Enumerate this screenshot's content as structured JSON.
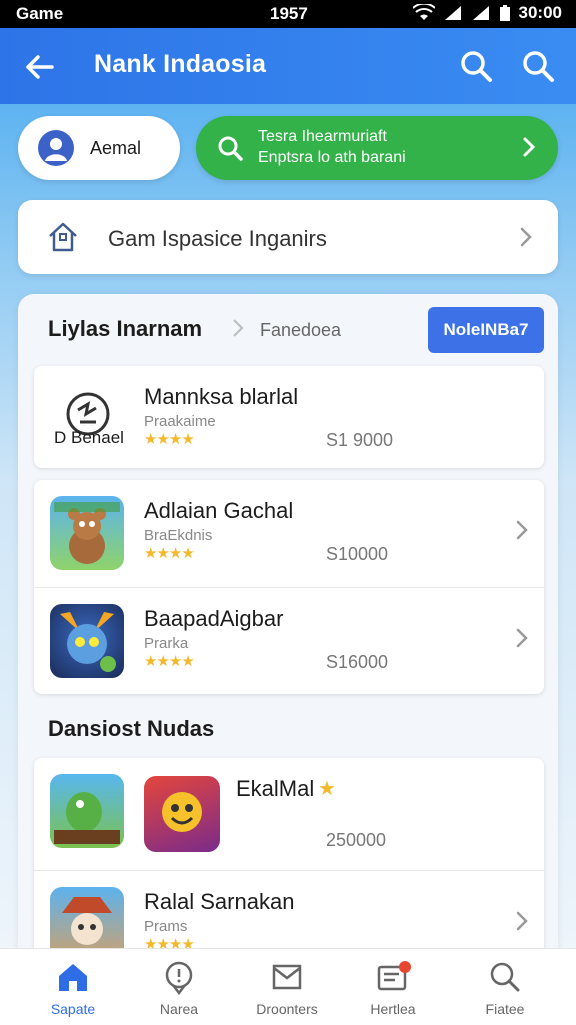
{
  "status_bar": {
    "carrier": "Game",
    "time": "1957",
    "clock": "30:00"
  },
  "app_bar": {
    "title": "Nank Indaosia"
  },
  "user_pill": {
    "label": "Aemal"
  },
  "search_pill": {
    "line1": "Tesra Ihearmuriaft",
    "line2": "Enptsra lo ath barani"
  },
  "banner": {
    "label": "Gam Ispasice Inganirs"
  },
  "panel": {
    "title": "Liylas Inarnam",
    "subtitle": "Fanedoea",
    "button_label": "NoleINBa7",
    "section_title": "Dansiost Nudas"
  },
  "card1": {
    "name": "Mannksa blarlal",
    "meta": "Praakaime",
    "price": "S1 9000",
    "icon_label": "D Benael"
  },
  "card2_rows": [
    {
      "name": "Adlaian Gachal",
      "meta": "BraEkdnis",
      "price": "S10000"
    },
    {
      "name": "BaapadAigbar",
      "meta": "Prarka",
      "price": "S16000"
    }
  ],
  "card3_rows": [
    {
      "name": "EkalMal",
      "price": "250000"
    },
    {
      "name": "Ralal Sarnakan",
      "meta": "Prams"
    }
  ],
  "stars": "★★★★",
  "bottom_nav": [
    {
      "label": "Sapate"
    },
    {
      "label": "Narea"
    },
    {
      "label": "Droonters"
    },
    {
      "label": "Hertlea"
    },
    {
      "label": "Fiatee"
    }
  ],
  "colors": {
    "app_bar": "#3180ee",
    "search_pill": "#33b249",
    "primary_button": "#3d71e8"
  }
}
